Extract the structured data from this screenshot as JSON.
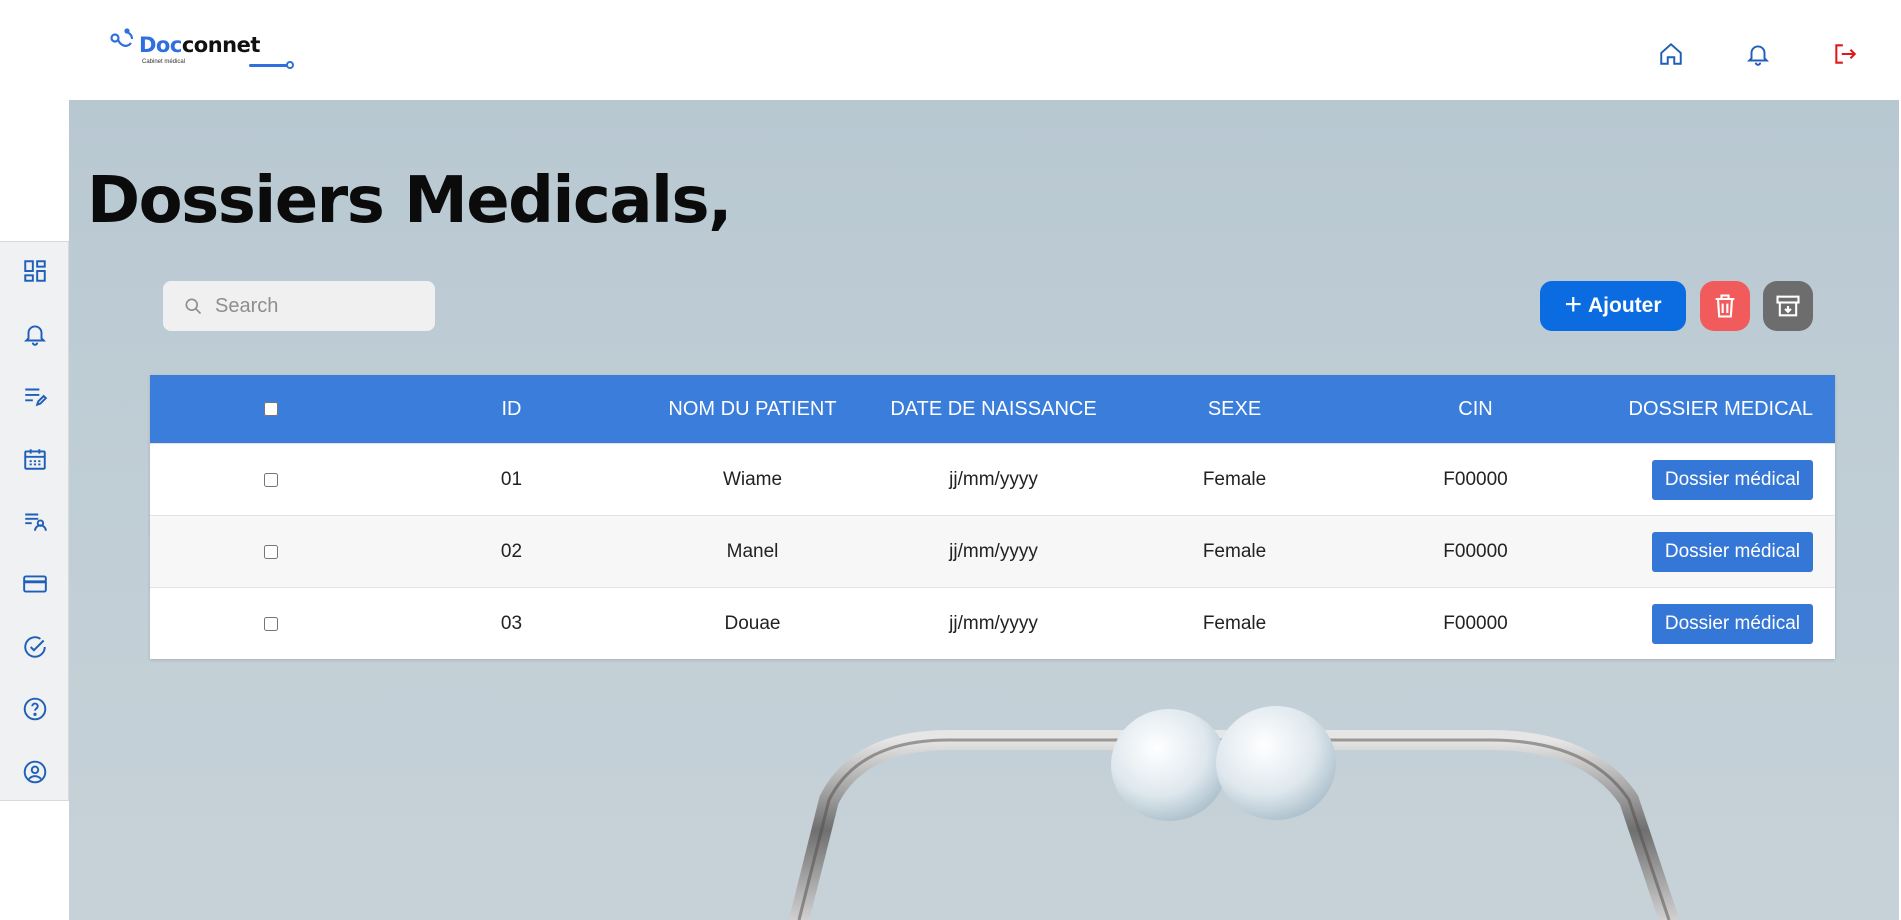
{
  "brand": {
    "name_part1": "Doc",
    "name_part2": "connet",
    "subtitle": "Cabinet médical",
    "color": "#2f6fe0"
  },
  "header": {
    "icons": [
      "home-icon",
      "bell-icon",
      "logout-icon"
    ]
  },
  "sidebar": {
    "items": [
      {
        "icon": "dashboard-icon"
      },
      {
        "icon": "bell-icon"
      },
      {
        "icon": "edit-list-icon"
      },
      {
        "icon": "calendar-icon"
      },
      {
        "icon": "patient-list-icon"
      },
      {
        "icon": "credit-card-icon"
      },
      {
        "icon": "check-circle-icon"
      },
      {
        "icon": "help-icon"
      },
      {
        "icon": "user-circle-icon"
      }
    ]
  },
  "page": {
    "title": "Dossiers Medicals,"
  },
  "toolbar": {
    "search_placeholder": "Search",
    "add_label": "Ajouter",
    "add_color": "#0b6be0",
    "delete_color": "#f15b5b",
    "archive_color": "#6d6d6d"
  },
  "table": {
    "columns": [
      "ID",
      "NOM DU PATIENT",
      "DATE DE NAISSANCE",
      "SEXE",
      "CIN",
      "DOSSIER MEDICAL"
    ],
    "header_color": "#3b7ddb",
    "rows": [
      {
        "id": "01",
        "name": "Wiame",
        "birth": "jj/mm/yyyy",
        "sex": "Female",
        "cin": "F00000",
        "action": "Dossier médical"
      },
      {
        "id": "02",
        "name": "Manel",
        "birth": "jj/mm/yyyy",
        "sex": "Female",
        "cin": "F00000",
        "action": "Dossier médical"
      },
      {
        "id": "03",
        "name": "Douae",
        "birth": "jj/mm/yyyy",
        "sex": "Female",
        "cin": "F00000",
        "action": "Dossier médical"
      }
    ]
  }
}
